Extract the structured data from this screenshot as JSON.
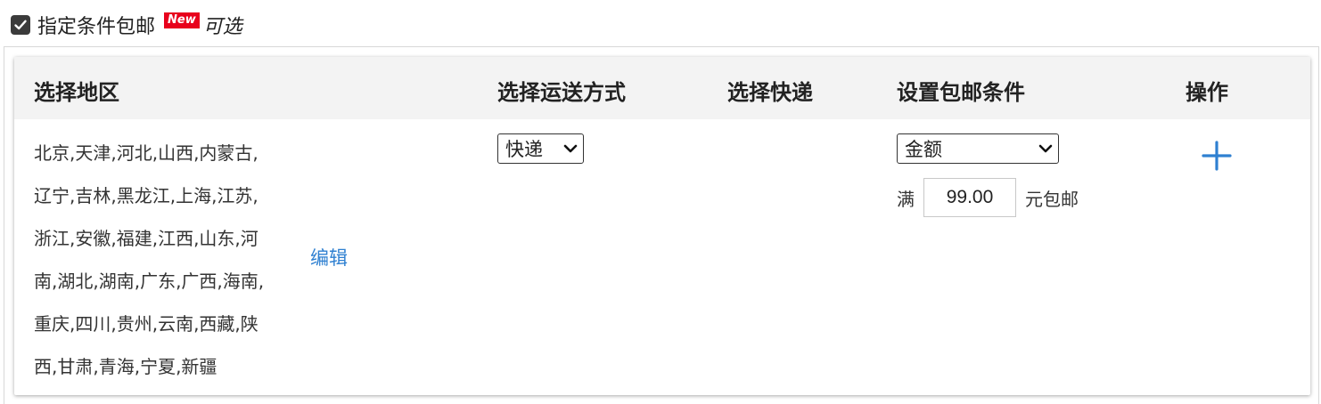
{
  "header": {
    "checkbox_checked": true,
    "title": "指定条件包邮",
    "badge": "New",
    "optional": "可选",
    "badge_color": "#e8001c"
  },
  "table": {
    "columns": [
      "选择地区",
      "选择运送方式",
      "选择快递",
      "设置包邮条件",
      "操作"
    ],
    "row": {
      "region_lines": [
        "北京,天津,河北,山西,内蒙古,",
        "辽宁,吉林,黑龙江,上海,江苏,",
        "浙江,安徽,福建,江西,山东,河",
        "南,湖北,湖南,广东,广西,海南,",
        "重庆,四川,贵州,云南,西藏,陕",
        "西,甘肃,青海,宁夏,新疆"
      ],
      "edit_label": "编辑",
      "shipping_method": "快递",
      "condition_type": "金额",
      "condition_prefix": "满",
      "condition_value": "99.00",
      "condition_suffix": "元包邮",
      "add_icon": "plus-icon"
    }
  },
  "colors": {
    "link": "#2f80d1",
    "header_bg": "#f3f3f3"
  }
}
